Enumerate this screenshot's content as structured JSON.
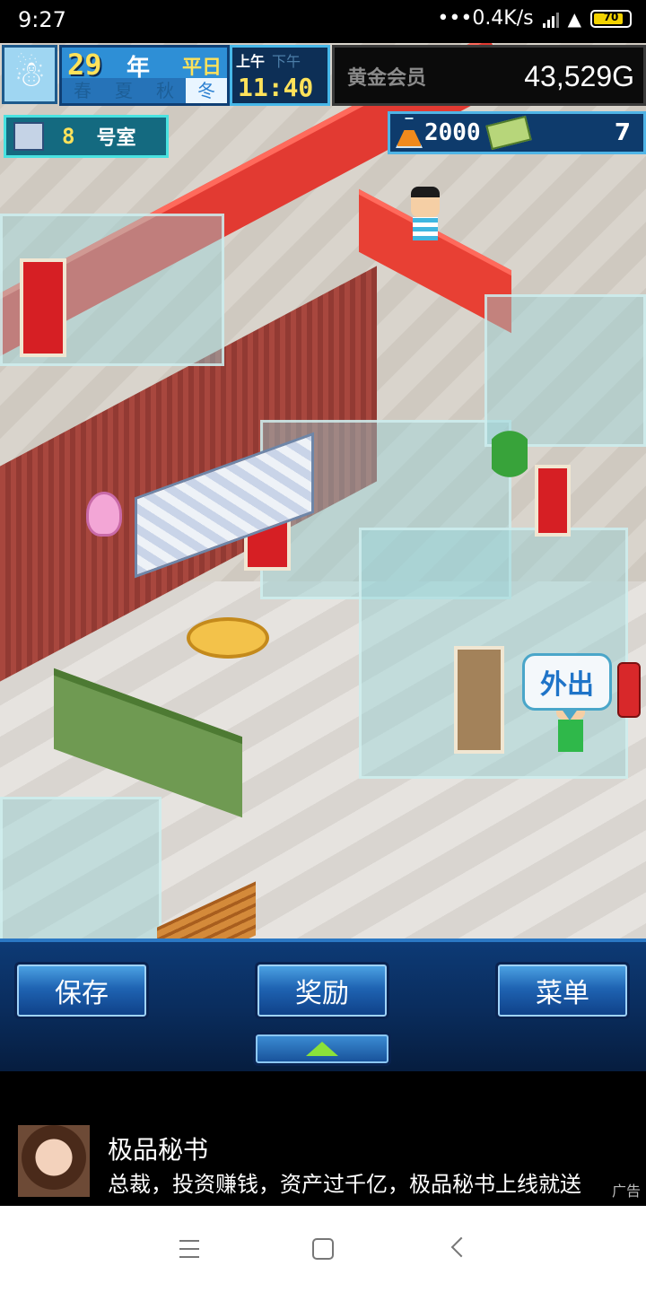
{
  "status_bar": {
    "time": "9:27",
    "network_speed": "•••0.4K/s",
    "battery": "70"
  },
  "hud": {
    "year_number": "29",
    "year_label": "年",
    "day_type": "平日",
    "seasons": [
      "春",
      "夏",
      "秋",
      "冬"
    ],
    "active_season": "冬",
    "am_label": "上午",
    "pm_label": "下午",
    "clock": "11:40",
    "member_label": "黄金会员",
    "gold": "43,529G",
    "room_number": "8",
    "room_label": "号室",
    "research_points": "2000",
    "ticket_count": "7"
  },
  "game": {
    "speech_bubble": "外出"
  },
  "menu": {
    "save_label": "保存",
    "reward_label": "奖励",
    "menu_label": "菜单"
  },
  "ad": {
    "title": "极品秘书",
    "description": "总裁，投资赚钱，资产过千亿，极品秘书上线就送",
    "tag": "广告"
  },
  "colors": {
    "menu_bg": "#0a2d5e",
    "button_blue": "#1f64b3",
    "gold_text": "#ffe25a",
    "speech_text": "#1f74c8"
  },
  "icons": [
    "snowman-icon",
    "room-icon",
    "flask-icon",
    "ticket-icon",
    "up-arrow-icon",
    "wifi-icon",
    "battery-icon"
  ]
}
